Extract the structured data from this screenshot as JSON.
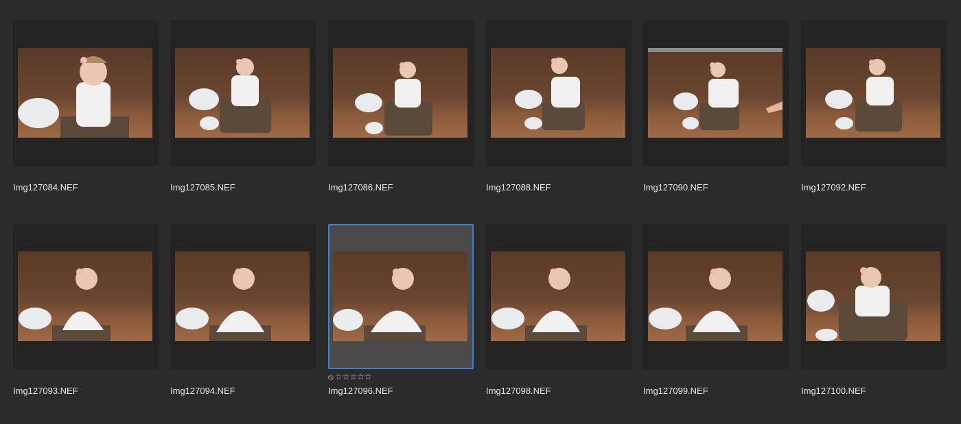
{
  "thumbnails": [
    {
      "filename": "Img127084.NEF",
      "selected": false
    },
    {
      "filename": "Img127085.NEF",
      "selected": false
    },
    {
      "filename": "Img127086.NEF",
      "selected": false
    },
    {
      "filename": "Img127088.NEF",
      "selected": false
    },
    {
      "filename": "Img127090.NEF",
      "selected": false
    },
    {
      "filename": "Img127092.NEF",
      "selected": false
    },
    {
      "filename": "Img127093.NEF",
      "selected": false
    },
    {
      "filename": "Img127094.NEF",
      "selected": false
    },
    {
      "filename": "Img127096.NEF",
      "selected": true,
      "rating": {
        "reject_icon": "⦸",
        "stars": "☆☆☆☆☆"
      }
    },
    {
      "filename": "Img127098.NEF",
      "selected": false
    },
    {
      "filename": "Img127099.NEF",
      "selected": false
    },
    {
      "filename": "Img127100.NEF",
      "selected": false
    }
  ],
  "colors": {
    "background": "#2b2b2b",
    "thumb_frame": "#232323",
    "selected_frame": "#4a4a4a",
    "selection_border": "#3b82e0"
  }
}
